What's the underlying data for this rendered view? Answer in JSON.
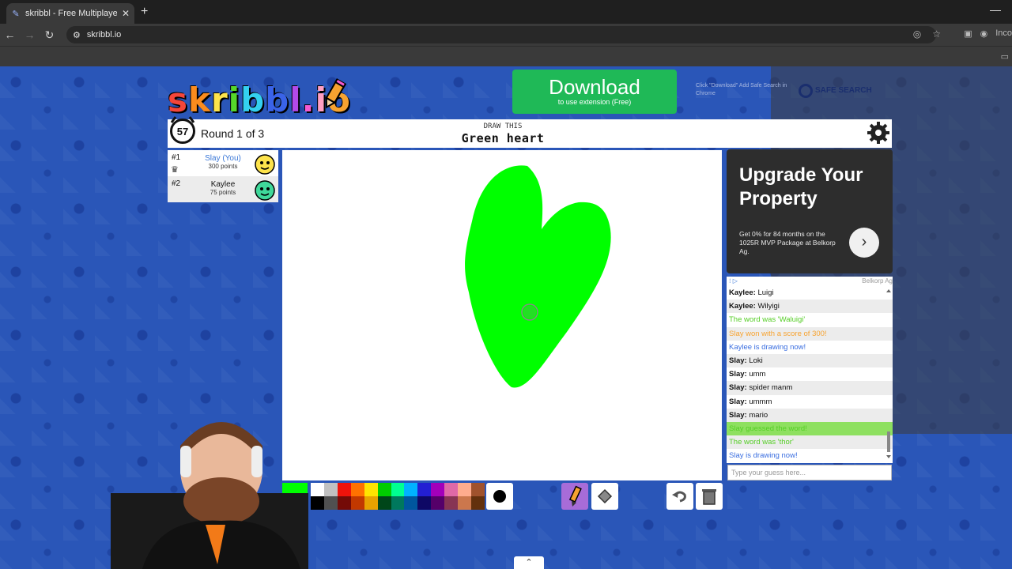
{
  "browser": {
    "tab_title": "skribbl - Free Multiplayer Draw",
    "url": "skribbl.io",
    "profile_label": "Inco"
  },
  "header": {
    "logo_text": "skribbl.io",
    "download_label": "Download",
    "download_sub": "to use extension (Free)",
    "download_hint": "Click \"Download\" Add Safe Search in Chrome",
    "safe_search_label": "SAFE SEARCH"
  },
  "game": {
    "timer": "57",
    "round": "Round 1 of 3",
    "draw_this_label": "DRAW THIS",
    "word": "Green heart"
  },
  "players": [
    {
      "rank": "#1",
      "name": "Slay (You)",
      "points": "300 points",
      "is_you": true,
      "avatar_color": "#fde34b"
    },
    {
      "rank": "#2",
      "name": "Kaylee",
      "points": "75 points",
      "is_you": false,
      "avatar_color": "#3fd89a"
    }
  ],
  "ad": {
    "title": "Upgrade Your Property",
    "body": "Get 0% for 84 months on the 1025R MVP Package at Belkorp Ag.",
    "advertiser": "Belkorp Ag"
  },
  "chat": [
    {
      "name": "Kaylee",
      "text": "Luigi",
      "style": "normal"
    },
    {
      "name": "Kaylee",
      "text": "Wilyigi",
      "style": "normal"
    },
    {
      "name": "",
      "text": "The word was 'Waluigi'",
      "style": "green"
    },
    {
      "name": "",
      "text": "Slay won with a score of 300!",
      "style": "orange"
    },
    {
      "name": "",
      "text": "Kaylee is drawing now!",
      "style": "blue"
    },
    {
      "name": "Slay",
      "text": "Loki",
      "style": "normal"
    },
    {
      "name": "Slay",
      "text": "umm",
      "style": "normal"
    },
    {
      "name": "Slay",
      "text": "spider manm",
      "style": "normal"
    },
    {
      "name": "Slay",
      "text": "ummm",
      "style": "normal"
    },
    {
      "name": "Slay",
      "text": "mario",
      "style": "normal"
    },
    {
      "name": "",
      "text": "Slay guessed the word!",
      "style": "greenbg"
    },
    {
      "name": "",
      "text": "The word was 'thor'",
      "style": "green"
    },
    {
      "name": "",
      "text": "Slay is drawing now!",
      "style": "blue"
    }
  ],
  "chat_input_placeholder": "Type your guess here...",
  "toolbar": {
    "current_color": "#00ff00",
    "palette": [
      "#ffffff",
      "#c1c1c1",
      "#ef130b",
      "#ff7100",
      "#ffe400",
      "#00cc00",
      "#00ff91",
      "#00b2ff",
      "#231fd3",
      "#a300ba",
      "#df69a7",
      "#ffac8e",
      "#a0522d",
      "#000000",
      "#505050",
      "#740b07",
      "#c23800",
      "#e8a200",
      "#004619",
      "#00785d",
      "#00569e",
      "#0e0865",
      "#550069",
      "#873554",
      "#cc774d",
      "#63300d"
    ]
  }
}
